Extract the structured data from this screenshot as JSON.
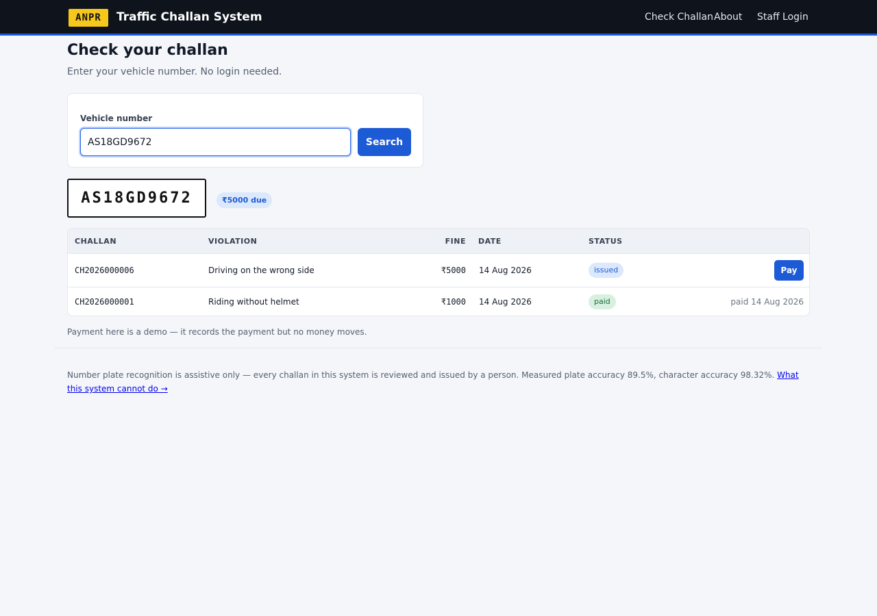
{
  "header": {
    "logo_text": "ANPR",
    "title": "Traffic Challan System",
    "nav": [
      "Check Challan",
      "About",
      "Staff Login"
    ]
  },
  "main": {
    "title": "Check your challan",
    "subtitle": "Enter your vehicle number. No login needed.",
    "search": {
      "label": "Vehicle number",
      "value": "AS18GD9672",
      "button": "Search"
    },
    "plate": "AS18GD9672",
    "due_badge": "₹5000 due",
    "table": {
      "headers": [
        "CHALLAN",
        "VIOLATION",
        "FINE",
        "DATE",
        "STATUS"
      ],
      "rows": [
        {
          "challan": "CH2026000006",
          "violation": "Driving on the wrong side",
          "fine": "₹5000",
          "date": "14 Aug 2026",
          "status": "issued",
          "action": "Pay"
        },
        {
          "challan": "CH2026000001",
          "violation": "Riding without helmet",
          "fine": "₹1000",
          "date": "14 Aug 2026",
          "status": "paid",
          "action": "paid 14 Aug 2026"
        }
      ]
    },
    "demo_note": "Payment here is a demo — it records the payment but no money moves."
  },
  "footer": {
    "text": "Number plate recognition is assistive only — every challan in this system is reviewed and issued by a person. Measured plate accuracy 89.5%, character accuracy 98.32%.",
    "link": "What this system cannot do →"
  },
  "colors": {
    "topbar": "#0e131c",
    "accent": "#1d5bd6",
    "logo": "#f7c81c",
    "background": "#f4f6fa"
  }
}
